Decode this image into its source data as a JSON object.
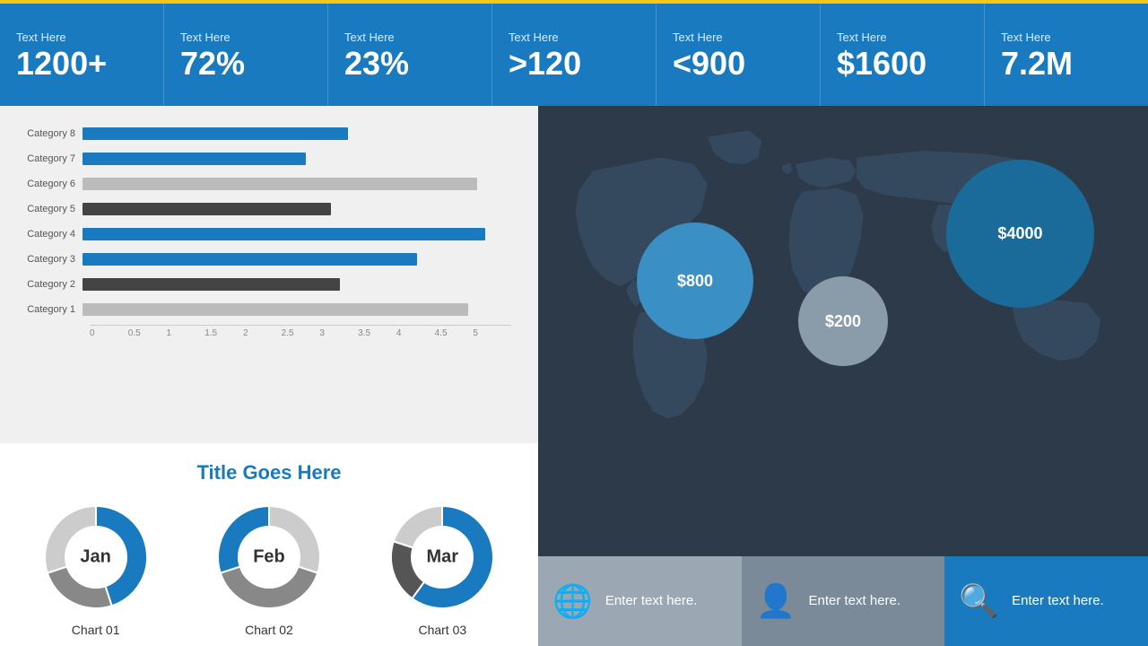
{
  "stats": [
    {
      "label": "Text Here",
      "value": "1200+"
    },
    {
      "label": "Text Here",
      "value": "72%"
    },
    {
      "label": "Text Here",
      "value": "23%"
    },
    {
      "label": "Text Here",
      "value": ">120"
    },
    {
      "label": "Text Here",
      "value": "<900"
    },
    {
      "label": "Text Here",
      "value": "$1600"
    },
    {
      "label": "Text Here",
      "value": "7.2M"
    }
  ],
  "bar_chart": {
    "bars": [
      {
        "label": "Category 8",
        "value": 3.1,
        "max": 5,
        "color": "blue"
      },
      {
        "label": "Category 7",
        "value": 2.6,
        "max": 5,
        "color": "blue"
      },
      {
        "label": "Category 6",
        "value": 4.6,
        "max": 5,
        "color": "gray"
      },
      {
        "label": "Category 5",
        "value": 2.9,
        "max": 5,
        "color": "dark"
      },
      {
        "label": "Category 4",
        "value": 4.7,
        "max": 5,
        "color": "blue"
      },
      {
        "label": "Category 3",
        "value": 3.9,
        "max": 5,
        "color": "blue"
      },
      {
        "label": "Category 2",
        "value": 3.0,
        "max": 5,
        "color": "dark"
      },
      {
        "label": "Category 1",
        "value": 4.5,
        "max": 5,
        "color": "gray"
      }
    ],
    "axis_labels": [
      "0",
      "0.5",
      "1",
      "1.5",
      "2",
      "2.5",
      "3",
      "3.5",
      "4",
      "4.5",
      "5"
    ]
  },
  "donut_section": {
    "title": "Title Goes Here",
    "charts": [
      {
        "label": "Chart 01",
        "month": "Jan",
        "segments": [
          {
            "pct": 45,
            "color": "#1a7abf"
          },
          {
            "pct": 25,
            "color": "#888"
          },
          {
            "pct": 30,
            "color": "#ccc"
          }
        ]
      },
      {
        "label": "Chart 02",
        "month": "Feb",
        "segments": [
          {
            "pct": 30,
            "color": "#ccc"
          },
          {
            "pct": 40,
            "color": "#888"
          },
          {
            "pct": 30,
            "color": "#1a7abf"
          }
        ]
      },
      {
        "label": "Chart 03",
        "month": "Mar",
        "segments": [
          {
            "pct": 60,
            "color": "#1a7abf"
          },
          {
            "pct": 20,
            "color": "#555"
          },
          {
            "pct": 20,
            "color": "#ccc"
          }
        ]
      }
    ]
  },
  "map_bubbles": [
    {
      "value": "$800",
      "class": "bubble-800"
    },
    {
      "value": "$200",
      "class": "bubble-200"
    },
    {
      "value": "$4000",
      "class": "bubble-4000"
    }
  ],
  "bottom_bar": [
    {
      "icon": "🌐",
      "text": "Enter text here."
    },
    {
      "icon": "👤",
      "text": "Enter text here."
    },
    {
      "icon": "🔍",
      "text": "Enter text here."
    }
  ]
}
